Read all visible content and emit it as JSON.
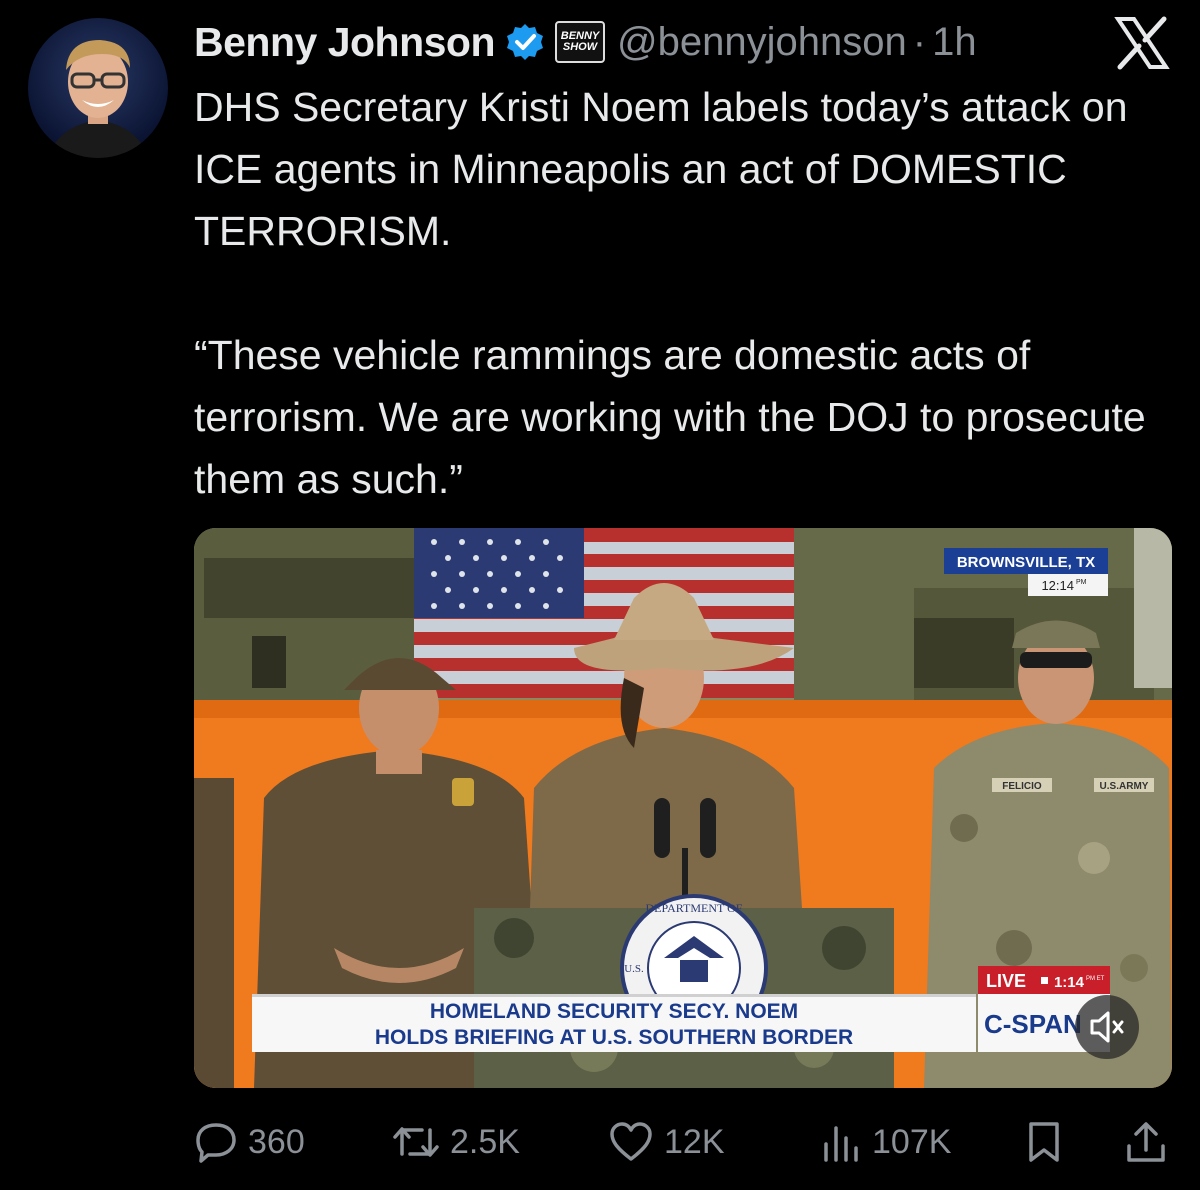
{
  "author": {
    "display_name": "Benny Johnson",
    "handle": "@bennyjohnson",
    "separator": "·",
    "time": "1h",
    "show_logo_lines": [
      "BENNY",
      "SHOW"
    ]
  },
  "tweet": {
    "text": "DHS Secretary Kristi Noem labels today’s attack on ICE agents in Minneapolis an act of DOMESTIC TERRORISM.\n\n“These vehicle rammings are domestic acts of terrorism. We are working with the DOJ to prosecute them as such.”"
  },
  "media": {
    "location": "BROWNSVILLE, TX",
    "location_time": "12:14",
    "location_time_suffix": "PM",
    "live_label": "LIVE",
    "live_time": "1:14",
    "live_time_suffix": "PM ET",
    "chyron_line1": "HOMELAND SECURITY SECY. NOEM",
    "chyron_line2": "HOLDS BRIEFING AT U.S. SOUTHERN BORDER",
    "network": "C-SPAN",
    "seal_text": "DEPARTMENT OF",
    "seal_side": "U.S.",
    "name_tape": "FELICIO",
    "army_tape": "U.S.ARMY"
  },
  "actions": {
    "replies": "360",
    "reposts": "2.5K",
    "likes": "12K",
    "views": "107K"
  },
  "colors": {
    "background": "#000000",
    "text": "#e7e9ea",
    "muted": "#8b9197",
    "verified": "#1d9bf0",
    "chyron_text": "#1a3a8c",
    "backdrop_orange": "#f07a1e"
  }
}
